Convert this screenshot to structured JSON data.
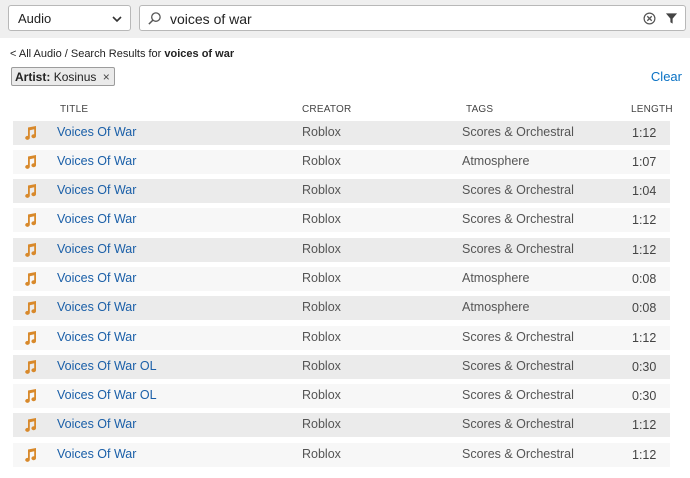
{
  "toolbar": {
    "category": "Audio",
    "search_value": "voices of war",
    "search_placeholder": ""
  },
  "breadcrumb": {
    "prefix": "< ",
    "root": "All Audio",
    "sep": " / ",
    "label": "Search Results for ",
    "query": "voices of war"
  },
  "filter": {
    "key": "Artist:",
    "value": "Kosinus",
    "remove": "×",
    "clear": "Clear"
  },
  "columns": {
    "title": "TITLE",
    "creator": "CREATOR",
    "tags": "TAGS",
    "length": "LENGTH"
  },
  "rows": [
    {
      "title": "Voices Of War",
      "creator": "Roblox",
      "tags": "Scores & Orchestral",
      "length": "1:12"
    },
    {
      "title": "Voices Of War",
      "creator": "Roblox",
      "tags": "Atmosphere",
      "length": "1:07"
    },
    {
      "title": "Voices Of War",
      "creator": "Roblox",
      "tags": "Scores & Orchestral",
      "length": "1:04"
    },
    {
      "title": "Voices Of War",
      "creator": "Roblox",
      "tags": "Scores & Orchestral",
      "length": "1:12"
    },
    {
      "title": "Voices Of War",
      "creator": "Roblox",
      "tags": "Scores & Orchestral",
      "length": "1:12"
    },
    {
      "title": "Voices Of War",
      "creator": "Roblox",
      "tags": "Atmosphere",
      "length": "0:08"
    },
    {
      "title": "Voices Of War",
      "creator": "Roblox",
      "tags": "Atmosphere",
      "length": "0:08"
    },
    {
      "title": "Voices Of War",
      "creator": "Roblox",
      "tags": "Scores & Orchestral",
      "length": "1:12"
    },
    {
      "title": "Voices Of War OL",
      "creator": "Roblox",
      "tags": "Scores & Orchestral",
      "length": "0:30"
    },
    {
      "title": "Voices Of War OL",
      "creator": "Roblox",
      "tags": "Scores & Orchestral",
      "length": "0:30"
    },
    {
      "title": "Voices Of War",
      "creator": "Roblox",
      "tags": "Scores & Orchestral",
      "length": "1:12"
    },
    {
      "title": "Voices Of War",
      "creator": "Roblox",
      "tags": "Scores & Orchestral",
      "length": "1:12"
    }
  ],
  "icons": {
    "row": "music-note-icon",
    "search": "search-icon",
    "clear": "clear-circle-icon",
    "filter": "filter-funnel-icon",
    "dropdown": "chevron-down-icon"
  },
  "colors": {
    "link": "#1a5fa8",
    "accent_link": "#0a72c4",
    "note_icon": "#d8892b",
    "row_alt_dark": "#ebebeb",
    "row_alt_light": "#f7f7f7"
  }
}
